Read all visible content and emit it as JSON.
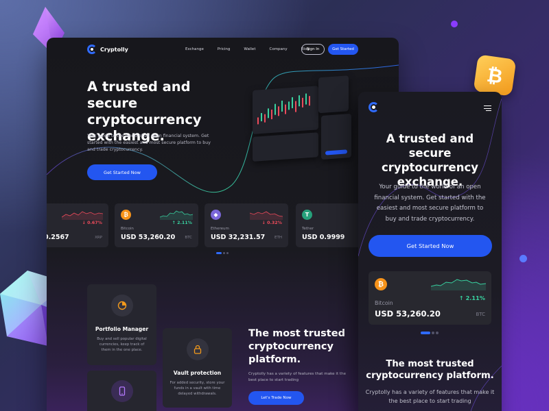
{
  "desktop": {
    "brand": "Cryptolly",
    "nav": [
      "Exchange",
      "Pricing",
      "Wallet",
      "Company",
      "Blog"
    ],
    "sign_in": "Sign In",
    "get_started": "Get Started",
    "hero": {
      "title": "A trusted and secure cryptocurrency exchange.",
      "subtitle": "Your guide to the world of an open financial system. Get started with the easiest and most secure platform to buy and trade cryptocurrency.",
      "cta": "Get Started Now"
    },
    "prices": [
      {
        "name": "",
        "price": "0.2567",
        "symbol": "XRP",
        "change": "0.67%",
        "direction": "down",
        "color": "#ef4b5b"
      },
      {
        "name": "Bitcoin",
        "price": "USD 53,260.20",
        "symbol": "BTC",
        "change": "2.11%",
        "direction": "up",
        "color": "#39d3a1",
        "icon": "bitcoin-icon",
        "coin_color": "#f7931a",
        "glyph": "₿"
      },
      {
        "name": "Ethereum",
        "price": "USD 32,231.57",
        "symbol": "ETH",
        "change": "0.32%",
        "direction": "down",
        "color": "#ef4b5b",
        "icon": "ethereum-icon",
        "coin_color": "#7b67d8",
        "glyph": "◆"
      },
      {
        "name": "Tether",
        "price": "USD 0.9999",
        "symbol": "",
        "change": "",
        "direction": "",
        "icon": "tether-icon",
        "coin_color": "#26a17b",
        "glyph": "T"
      }
    ],
    "features": [
      {
        "title": "Portfolio Manager",
        "desc": "Buy and sell popular digital currencies, keep track of them in the one place.",
        "icon": "pie-chart-icon"
      },
      {
        "title": "Vault protection",
        "desc": "For added security, store your funds in a vault with time delayed withdrawals.",
        "icon": "lock-icon"
      },
      {
        "title": "",
        "desc": "",
        "icon": "mobile-icon"
      }
    ],
    "trusted": {
      "title": "The most trusted cryptocurrency platform.",
      "subtitle": "Cryptolly has a variety of features that make it the best place to start trading",
      "cta": "Let's Trade Now"
    }
  },
  "mobile": {
    "hero_title": "A trusted and secure cryptocurrency exchange.",
    "hero_subtitle": "Your guide to the world of an open financial system. Get started with the easiest and most secure platform to buy and trade cryptocurrency.",
    "cta": "Get Started Now",
    "card": {
      "name": "Bitcoin",
      "price": "USD 53,260.20",
      "symbol": "BTC",
      "change": "2.11%",
      "direction": "up",
      "icon": "bitcoin-icon"
    },
    "trusted_title": "The most trusted cryptocurrency platform.",
    "trusted_subtitle": "Cryptolly has a variety of features that make it the best place to start trading"
  },
  "colors": {
    "accent": "#2356f0",
    "up": "#39d3a1",
    "down": "#ef4b5b",
    "bitcoin": "#f7931a"
  }
}
